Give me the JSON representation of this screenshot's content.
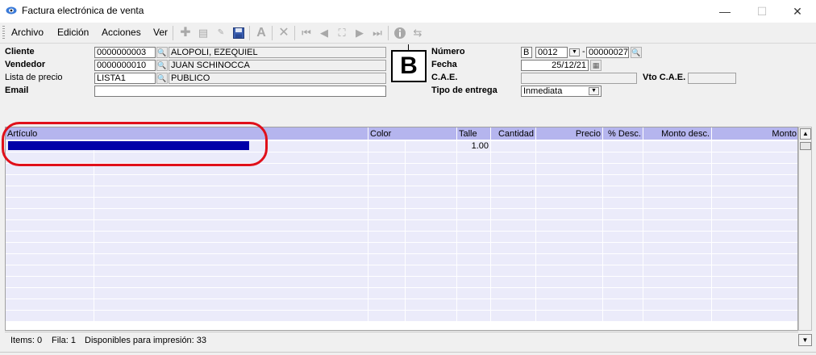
{
  "window": {
    "title": "Factura electrónica de venta",
    "minimize_glyph": "—",
    "maximize_glyph": "☐",
    "close_glyph": "✕"
  },
  "menu": {
    "items": [
      "Archivo",
      "Edición",
      "Acciones",
      "Ver"
    ]
  },
  "toolbar": {
    "icons": [
      "add-icon",
      "copy-icon",
      "edit-icon",
      "save-icon",
      "font-icon",
      "delete-icon",
      "first-icon",
      "prev-icon",
      "find-icon",
      "next-icon",
      "last-icon",
      "info-icon",
      "convert-icon"
    ]
  },
  "form": {
    "cliente_label": "Cliente",
    "cliente_code": "0000000003",
    "cliente_name": "ALOPOLI, EZEQUIEL",
    "vendedor_label": "Vendedor",
    "vendedor_code": "0000000010",
    "vendedor_name": "JUAN SCHINOCCA",
    "lista_label": "Lista de precio",
    "lista_code": "LISTA1",
    "lista_name": "PUBLICO",
    "email_label": "Email",
    "email_value": "",
    "comprobante_letra": "B",
    "numero_label": "Número",
    "numero_letra": "B",
    "numero_pv": "0012",
    "numero_sep": "-",
    "numero_nro": "00000027",
    "fecha_label": "Fecha",
    "fecha_value": "25/12/21",
    "cae_label": "C.A.E.",
    "cae_value": "",
    "vto_cae_label": "Vto C.A.E.",
    "vto_cae_value": "",
    "tipo_entrega_label": "Tipo de entrega",
    "tipo_entrega_value": "Inmediata"
  },
  "grid": {
    "columns": [
      "Artículo",
      "Color",
      "Talle",
      "Cantidad",
      "Precio",
      "% Desc.",
      "Monto desc.",
      "Monto"
    ],
    "first_row_cantidad": "1.00"
  },
  "status": {
    "items": "Items: 0",
    "fila": "Fila: 1",
    "disponibles": "Disponibles para impresión: 33"
  },
  "colors": {
    "header_bg": "#b5b5ee",
    "row_bg": "#ebebfa",
    "selection": "#0000a8",
    "annotation": "#e0101a"
  }
}
